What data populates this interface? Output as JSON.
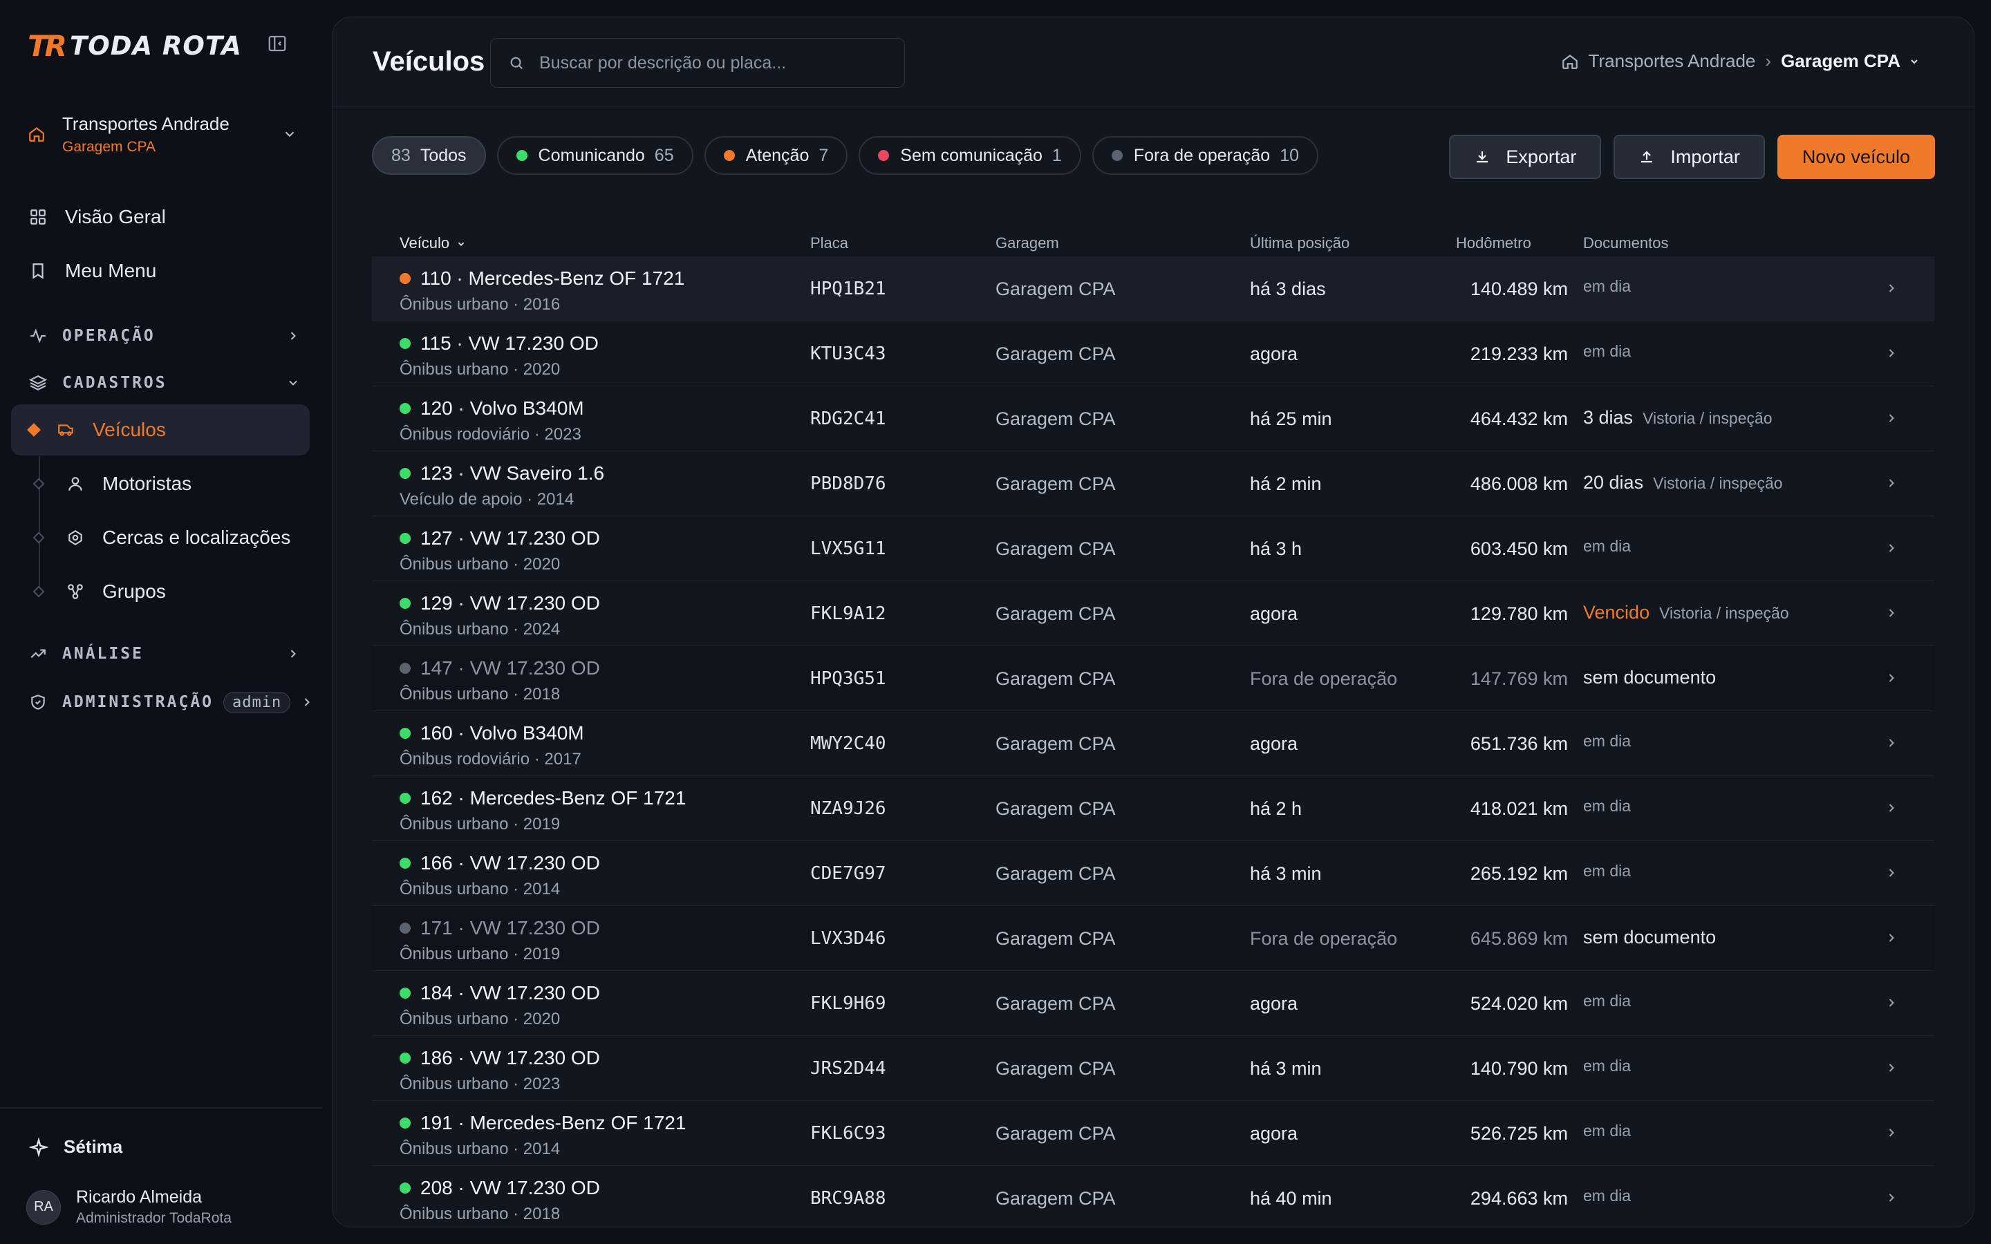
{
  "brand": {
    "mark": "TR",
    "name": "TODA ROTA"
  },
  "org": {
    "name": "Transportes Andrade",
    "garage": "Garagem CPA"
  },
  "nav": {
    "overview": "Visão Geral",
    "my_menu": "Meu Menu",
    "operacao": "OPERAÇÃO",
    "cadastros": "CADASTROS",
    "veiculos": "Veículos",
    "motoristas": "Motoristas",
    "cercas": "Cercas e localizações",
    "grupos": "Grupos",
    "analise": "ANÁLISE",
    "administracao": "ADMINISTRAÇÃO",
    "admin_badge": "admin"
  },
  "footer": {
    "org": "Sétima",
    "user_initials": "RA",
    "user_name": "Ricardo Almeida",
    "user_role": "Administrador TodaRota"
  },
  "header": {
    "title": "Veículos",
    "search_placeholder": "Buscar por descrição ou placa...",
    "crumb_org": "Transportes Andrade",
    "crumb_sep": "›",
    "crumb_current": "Garagem CPA"
  },
  "filters": {
    "all_count": "83",
    "all_label": "Todos",
    "comm_label": "Comunicando",
    "comm_count": "65",
    "att_label": "Atenção",
    "att_count": "7",
    "nocomm_label": "Sem comunicação",
    "nocomm_count": "1",
    "off_label": "Fora de operação",
    "off_count": "10"
  },
  "actions": {
    "export": "Exportar",
    "import": "Importar",
    "new": "Novo veículo"
  },
  "table": {
    "headers": {
      "vehicle": "Veículo",
      "plate": "Placa",
      "garage": "Garagem",
      "last": "Última posição",
      "odo": "Hodômetro",
      "docs": "Documentos"
    },
    "rows": [
      {
        "title": "110 · Mercedes-Benz OF 1721",
        "sub": "Ônibus urbano · 2016",
        "status": "attention",
        "plate": "HPQ1B21",
        "garage": "Garagem CPA",
        "last": "há 3 dias",
        "odo": "140.489 km",
        "doc_main": "",
        "doc_note": "em dia"
      },
      {
        "title": "115 · VW 17.230 OD",
        "sub": "Ônibus urbano · 2020",
        "status": "ok",
        "plate": "KTU3C43",
        "garage": "Garagem CPA",
        "last": "agora",
        "odo": "219.233 km",
        "doc_main": "",
        "doc_note": "em dia"
      },
      {
        "title": "120 · Volvo B340M",
        "sub": "Ônibus rodoviário · 2023",
        "status": "ok",
        "plate": "RDG2C41",
        "garage": "Garagem CPA",
        "last": "há 25 min",
        "odo": "464.432 km",
        "doc_main": "3 dias",
        "doc_note": "Vistoria / inspeção"
      },
      {
        "title": "123 · VW Saveiro 1.6",
        "sub": "Veículo de apoio · 2014",
        "status": "ok",
        "plate": "PBD8D76",
        "garage": "Garagem CPA",
        "last": "há 2 min",
        "odo": "486.008 km",
        "doc_main": "20 dias",
        "doc_note": "Vistoria / inspeção"
      },
      {
        "title": "127 · VW 17.230 OD",
        "sub": "Ônibus urbano · 2020",
        "status": "ok",
        "plate": "LVX5G11",
        "garage": "Garagem CPA",
        "last": "há 3 h",
        "odo": "603.450 km",
        "doc_main": "",
        "doc_note": "em dia"
      },
      {
        "title": "129 · VW 17.230 OD",
        "sub": "Ônibus urbano · 2024",
        "status": "ok",
        "plate": "FKL9A12",
        "garage": "Garagem CPA",
        "last": "agora",
        "odo": "129.780 km",
        "doc_main": "Vencido",
        "doc_note": "Vistoria / inspeção"
      },
      {
        "title": "147 · VW 17.230 OD",
        "sub": "Ônibus urbano · 2018",
        "status": "off",
        "plate": "HPQ3G51",
        "garage": "Garagem CPA",
        "last": "Fora de operação",
        "odo": "147.769 km",
        "doc_main": "sem documento",
        "doc_note": ""
      },
      {
        "title": "160 · Volvo B340M",
        "sub": "Ônibus rodoviário · 2017",
        "status": "ok",
        "plate": "MWY2C40",
        "garage": "Garagem CPA",
        "last": "agora",
        "odo": "651.736 km",
        "doc_main": "",
        "doc_note": "em dia"
      },
      {
        "title": "162 · Mercedes-Benz OF 1721",
        "sub": "Ônibus urbano · 2019",
        "status": "ok",
        "plate": "NZA9J26",
        "garage": "Garagem CPA",
        "last": "há 2 h",
        "odo": "418.021 km",
        "doc_main": "",
        "doc_note": "em dia"
      },
      {
        "title": "166 · VW 17.230 OD",
        "sub": "Ônibus urbano · 2014",
        "status": "ok",
        "plate": "CDE7G97",
        "garage": "Garagem CPA",
        "last": "há 3 min",
        "odo": "265.192 km",
        "doc_main": "",
        "doc_note": "em dia"
      },
      {
        "title": "171 · VW 17.230 OD",
        "sub": "Ônibus urbano · 2019",
        "status": "off",
        "plate": "LVX3D46",
        "garage": "Garagem CPA",
        "last": "Fora de operação",
        "odo": "645.869 km",
        "doc_main": "sem documento",
        "doc_note": ""
      },
      {
        "title": "184 · VW 17.230 OD",
        "sub": "Ônibus urbano · 2020",
        "status": "ok",
        "plate": "FKL9H69",
        "garage": "Garagem CPA",
        "last": "agora",
        "odo": "524.020 km",
        "doc_main": "",
        "doc_note": "em dia"
      },
      {
        "title": "186 · VW 17.230 OD",
        "sub": "Ônibus urbano · 2023",
        "status": "ok",
        "plate": "JRS2D44",
        "garage": "Garagem CPA",
        "last": "há 3 min",
        "odo": "140.790 km",
        "doc_main": "",
        "doc_note": "em dia"
      },
      {
        "title": "191 · Mercedes-Benz OF 1721",
        "sub": "Ônibus urbano · 2014",
        "status": "ok",
        "plate": "FKL6C93",
        "garage": "Garagem CPA",
        "last": "agora",
        "odo": "526.725 km",
        "doc_main": "",
        "doc_note": "em dia"
      },
      {
        "title": "208 · VW 17.230 OD",
        "sub": "Ônibus urbano · 2018",
        "status": "ok",
        "plate": "BRC9A88",
        "garage": "Garagem CPA",
        "last": "há 40 min",
        "odo": "294.663 km",
        "doc_main": "",
        "doc_note": "em dia"
      }
    ]
  },
  "colors": {
    "accent": "#f07a2a",
    "ok": "#3ddc6a",
    "attention": "#f07a2a",
    "error": "#e8475f",
    "off": "#5c626e"
  },
  "icons": {
    "brand": "toda-rota-logo",
    "collapse": "sidebar-collapse-icon",
    "org": "home-icon",
    "overview": "grid-icon",
    "menu": "bookmark-icon",
    "operacao": "activity-icon",
    "cadastros": "layers-icon",
    "veiculos": "bus-icon",
    "motoristas": "user-icon",
    "cercas": "map-pin-icon",
    "grupos": "nodes-icon",
    "analise": "trending-up-icon",
    "admin": "shield-icon",
    "org_footer": "sparkle-icon",
    "search": "search-icon",
    "export": "download-icon",
    "import": "upload-icon"
  }
}
